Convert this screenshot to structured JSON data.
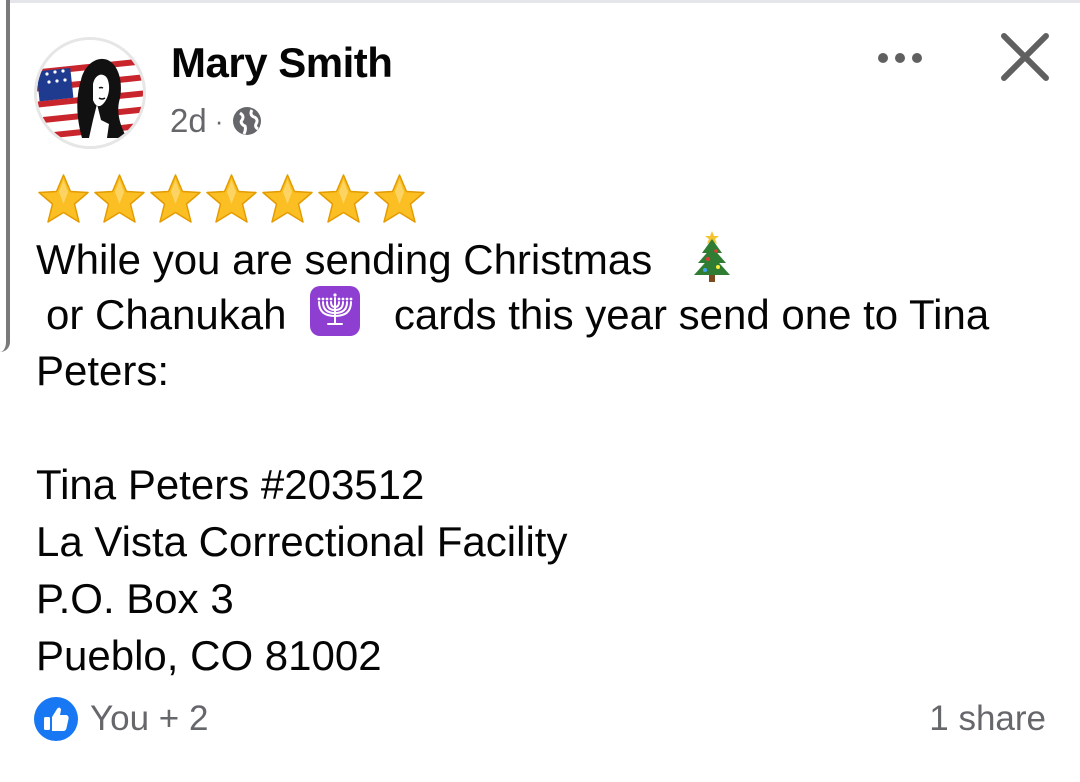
{
  "post": {
    "author": "Mary Smith",
    "time": "2d",
    "separator": "·",
    "audience_icon": "globe-icon",
    "rating_stars": 7,
    "lines": {
      "l1": "While you are sending Christmas",
      "l2a": "or Chanukah",
      "l2b": "cards this year send one to Tina",
      "l3": "Peters:",
      "a1": "Tina Peters #203512",
      "a2": "La Vista Correctional Facility",
      "a3": "P.O. Box 3",
      "a4": "Pueblo, CO 81002"
    },
    "emojis": [
      "christmas-tree-icon",
      "menorah-icon"
    ]
  },
  "footer": {
    "reactions": "You + 2",
    "shares": "1 share",
    "reaction_icon": "like-icon"
  },
  "colors": {
    "text": "#050505",
    "secondary": "#65676b",
    "like_blue": "#1877f2",
    "star_gold": "#fbbf24",
    "menorah_purple": "#8e3fd1"
  }
}
